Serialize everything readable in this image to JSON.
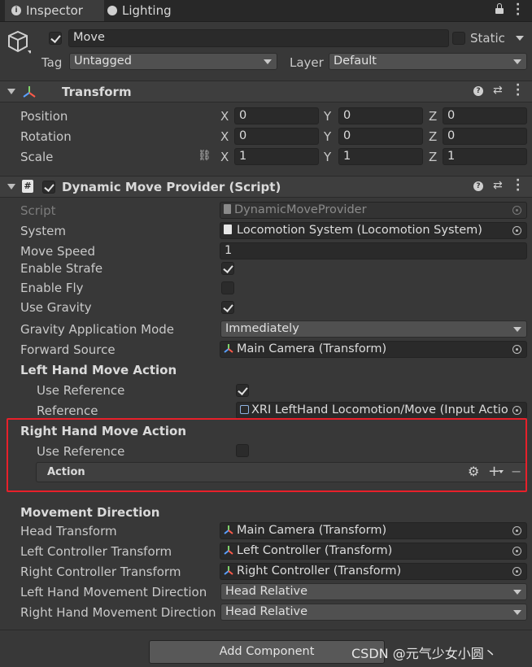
{
  "tabs": [
    {
      "label": "Inspector",
      "icon": "info-icon"
    },
    {
      "label": "Lighting",
      "icon": "lighting-icon"
    }
  ],
  "object": {
    "name": "Move",
    "active": true,
    "static_label": "Static",
    "static": false,
    "tag_label": "Tag",
    "tag_value": "Untagged",
    "layer_label": "Layer",
    "layer_value": "Default"
  },
  "transform": {
    "title": "Transform",
    "rows": [
      {
        "label": "Position",
        "x": "0",
        "y": "0",
        "z": "0"
      },
      {
        "label": "Rotation",
        "x": "0",
        "y": "0",
        "z": "0"
      },
      {
        "label": "Scale",
        "x": "1",
        "y": "1",
        "z": "1"
      }
    ],
    "axis": {
      "x": "X",
      "y": "Y",
      "z": "Z"
    }
  },
  "script_component": {
    "title": "Dynamic Move Provider (Script)",
    "enabled": true,
    "script_label": "Script",
    "script_value": "DynamicMoveProvider",
    "system_label": "System",
    "system_value": "Locomotion System (Locomotion System)",
    "move_speed_label": "Move Speed",
    "move_speed_value": "1",
    "enable_strafe_label": "Enable Strafe",
    "enable_strafe": true,
    "enable_fly_label": "Enable Fly",
    "enable_fly": false,
    "use_gravity_label": "Use Gravity",
    "use_gravity": true,
    "gravity_mode_label": "Gravity Application Mode",
    "gravity_mode_value": "Immediately",
    "forward_source_label": "Forward Source",
    "forward_source_value": "Main Camera (Transform)",
    "left_hand": {
      "title": "Left Hand Move Action",
      "use_reference_label": "Use Reference",
      "use_reference": true,
      "reference_label": "Reference",
      "reference_value": "XRI LeftHand Locomotion/Move (Input Actio"
    },
    "right_hand": {
      "title": "Right Hand Move Action",
      "use_reference_label": "Use Reference",
      "use_reference": false,
      "action_label": "Action"
    },
    "movement_direction": {
      "title": "Movement Direction",
      "head_transform_label": "Head Transform",
      "head_transform_value": "Main Camera (Transform)",
      "left_controller_label": "Left Controller Transform",
      "left_controller_value": "Left Controller (Transform)",
      "right_controller_label": "Right Controller Transform",
      "right_controller_value": "Right Controller (Transform)",
      "left_dir_label": "Left Hand Movement Direction",
      "left_dir_value": "Head Relative",
      "right_dir_label": "Right Hand Movement Direction",
      "right_dir_value": "Head Relative"
    }
  },
  "add_component_label": "Add Component",
  "watermark": "CSDN @元气少女小圆丶",
  "colors": {
    "background": "#383838",
    "highlight_box": "#e8202a"
  }
}
